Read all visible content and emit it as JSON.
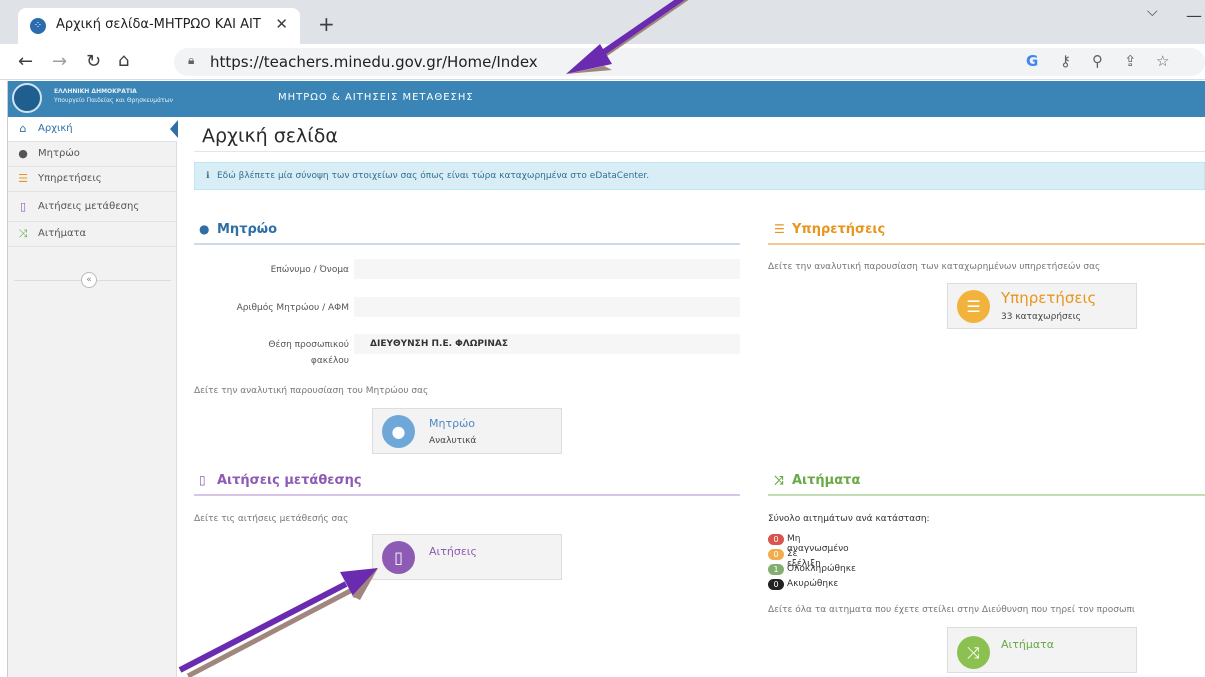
{
  "browser": {
    "tab_title": "Αρχική σελίδα-ΜΗΤΡΩΟ ΚΑΙ ΑΙΤ",
    "tab_close": "✕",
    "new_tab": "+",
    "url": "https://teachers.minedu.gov.gr/Home/Index",
    "icons": [
      "back-arrow-icon",
      "forward-arrow-icon",
      "reload-icon",
      "home-icon",
      "lock-icon",
      "google-icon",
      "key-icon",
      "zoom-icon",
      "share-icon",
      "star-icon"
    ]
  },
  "header": {
    "logo_line1": "ΕΛΛΗΝΙΚΗ ΔΗΜΟΚΡΑΤΙΑ",
    "logo_line2": "Υπουργείο Παιδείας και Θρησκευμάτων",
    "title": "ΜΗΤΡΩΟ & ΑΙΤΗΣΕΙΣ ΜΕΤΑΘΕΣΗΣ",
    "color": "#3a85b5"
  },
  "sidebar": {
    "items": [
      {
        "label": "Αρχική",
        "icon": "home-icon"
      },
      {
        "label": "Μητρώο",
        "icon": "user-icon"
      },
      {
        "label": "Υπηρετήσεις",
        "icon": "list-icon"
      },
      {
        "label": "Αιτήσεις μετάθεσης",
        "icon": "file-icon"
      },
      {
        "label": "Αιτήματα",
        "icon": "shuffle-icon"
      }
    ],
    "collapse_label": "«"
  },
  "main": {
    "page_title": "Αρχική σελίδα",
    "info": "Εδώ βλέπετε μία σύνοψη των στοιχείων σας όπως είναι τώρα καταχωρημένα στο eDataCenter.",
    "registry": {
      "heading": "Μητρώο",
      "field_name_label": "Επώνυμο / Όνομα",
      "field_name_value": "",
      "field_am_label": "Αριθμός Μητρώου / ΑΦΜ",
      "field_am_value": "",
      "field_pos_label1": "Θέση προσωπικού",
      "field_pos_label2": "φακέλου",
      "field_pos_value": "ΔΙΕΥΘΥΝΣΗ Π.Ε. ΦΛΩΡΙΝΑΣ",
      "note": "Δείτε την αναλυτική παρουσίαση του Μητρώου σας",
      "tile_title": "Μητρώο",
      "tile_sub": "Αναλυτικά"
    },
    "services": {
      "heading": "Υπηρετήσεις",
      "note": "Δείτε την αναλυτική παρουσίαση των καταχωρημένων υπηρετήσεών σας",
      "tile_title": "Υπηρετήσεις",
      "tile_sub": "33 καταχωρήσεις"
    },
    "transfers": {
      "heading": "Αιτήσεις μετάθεσης",
      "note": "Δείτε τις αιτήσεις μετάθεσής σας",
      "tile_title": "Αιτήσεις"
    },
    "requests": {
      "heading": "Αιτήματα",
      "summary": "Σύνολο αιτημάτων ανά κατάσταση:",
      "statuses": [
        {
          "count": "0",
          "label": "Μη αναγνωσμένο",
          "color": "#d9534f"
        },
        {
          "count": "0",
          "label": "Σε εξέλιξη",
          "color": "#f0ad4e"
        },
        {
          "count": "1",
          "label": "Ολοκληρώθηκε",
          "color": "#82af6f"
        },
        {
          "count": "0",
          "label": "Ακυρώθηκε",
          "color": "#222222"
        }
      ],
      "note": "Δείτε όλα τα αιτηματα που έχετε στείλει στην Διεύθυνση που τηρεί τον προσωπι",
      "tile_title": "Αιτήματα"
    }
  },
  "colors": {
    "blue": "#2f6fa5",
    "orange": "#e8951d",
    "purple": "#8e5bb4",
    "green": "#69aa46",
    "arrow": "#6a2bb0"
  }
}
